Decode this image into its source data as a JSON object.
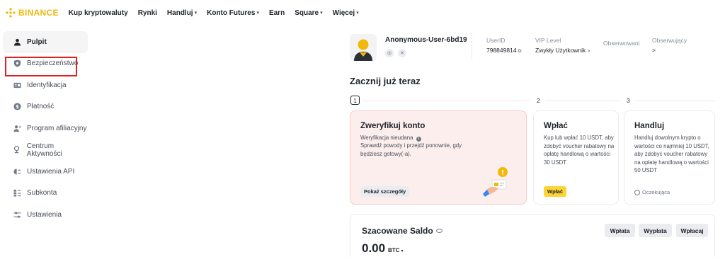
{
  "brand": {
    "name": "BINANCE",
    "accent": "#F0B90B",
    "alert": "#E02020"
  },
  "nav": {
    "items": [
      {
        "label": "Kup kryptowaluty",
        "has_caret": false
      },
      {
        "label": "Rynki",
        "has_caret": false
      },
      {
        "label": "Handluj",
        "has_caret": true
      },
      {
        "label": "Konto Futures",
        "has_caret": true
      },
      {
        "label": "Earn",
        "has_caret": false
      },
      {
        "label": "Square",
        "has_caret": true
      },
      {
        "label": "Więcej",
        "has_caret": true
      }
    ]
  },
  "sidebar": {
    "items": [
      {
        "label": "Pulpit",
        "icon": "user-icon",
        "active": true
      },
      {
        "label": "Bezpieczeństwo",
        "icon": "shield-icon",
        "active": false,
        "highlighted": true
      },
      {
        "label": "Identyfikacja",
        "icon": "id-card-icon",
        "active": false
      },
      {
        "label": "Płatność",
        "icon": "dollar-icon",
        "active": false
      },
      {
        "label": "Program afiliacyjny",
        "icon": "add-user-icon",
        "active": false
      },
      {
        "label": "Centrum Aktywności",
        "icon": "medal-icon",
        "active": false
      },
      {
        "label": "Ustawienia API",
        "icon": "api-icon",
        "active": false
      },
      {
        "label": "Subkonta",
        "icon": "subaccount-icon",
        "active": false
      },
      {
        "label": "Ustawienia",
        "icon": "settings-icon",
        "active": false
      }
    ]
  },
  "profile": {
    "username": "Anonymous-User-6bd19",
    "user_id_label": "UserID",
    "user_id": "798849814",
    "vip_label": "VIP Level",
    "vip_value": "Zwykły Użytkownik",
    "following_label": "Obserwowani",
    "followers_label": "Obserwujący",
    "followers_value": ">"
  },
  "getting_started": {
    "title": "Zacznij już teraz",
    "steps": [
      {
        "number": "1",
        "title": "Zweryfikuj konto",
        "status": "Weryfikacja nieudana",
        "text": "Sprawdź powody i przejdź ponownie, gdy będziesz gotowy(-a).",
        "button": "Pokaż szczegóły"
      },
      {
        "number": "2",
        "title": "Wpłać",
        "text": "Kup lub wpłać 10 USDT, aby zdobyć voucher rabatowy na opłatę handlową o wartości 30 USDT",
        "button": "Wpłać"
      },
      {
        "number": "3",
        "title": "Handluj",
        "text": "Handluj dowolnym krypto o wartości co najmniej 10 USDT, aby zdobyć voucher rabatowy na opłatę handlową o wartości 50 USDT",
        "status": "Oczekująca"
      }
    ]
  },
  "balance": {
    "title": "Szacowane Saldo",
    "amount": "0.00",
    "unit": "BTC",
    "buttons": [
      "Wpłata",
      "Wypłata",
      "Wpłacaj"
    ]
  }
}
